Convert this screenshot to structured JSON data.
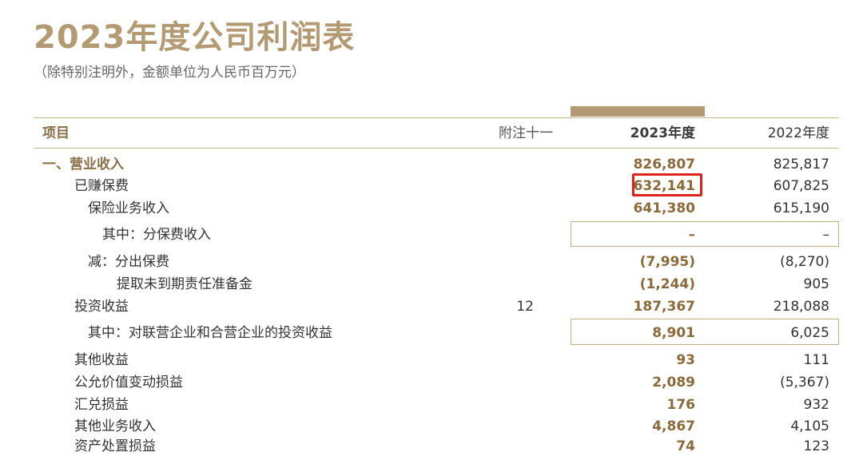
{
  "document": {
    "title": "2023年度公司利润表",
    "subtitle": "（除特别注明外，金额单位为人民币百万元）"
  },
  "table": {
    "headers": {
      "item": "项目",
      "note": "附注十一",
      "current": "2023年度",
      "previous": "2022年度"
    },
    "rows": [
      {
        "label": "一、营业收入",
        "note": "",
        "current": "826,807",
        "previous": "825,817"
      },
      {
        "label": "已赚保费",
        "note": "",
        "current": "632,141",
        "previous": "607,825"
      },
      {
        "label": "保险业务收入",
        "note": "",
        "current": "641,380",
        "previous": "615,190"
      },
      {
        "label": "其中：分保费收入",
        "note": "",
        "current": "–",
        "previous": "–"
      },
      {
        "label": "减：分出保费",
        "note": "",
        "current": "(7,995)",
        "previous": "(8,270)"
      },
      {
        "label": "提取未到期责任准备金",
        "note": "",
        "current": "(1,244)",
        "previous": "905"
      },
      {
        "label": "投资收益",
        "note": "12",
        "current": "187,367",
        "previous": "218,088"
      },
      {
        "label": "其中：对联营企业和合营企业的投资收益",
        "note": "",
        "current": "8,901",
        "previous": "6,025"
      },
      {
        "label": "其他收益",
        "note": "",
        "current": "93",
        "previous": "111"
      },
      {
        "label": "公允价值变动损益",
        "note": "",
        "current": "2,089",
        "previous": "(5,367)"
      },
      {
        "label": "汇兑损益",
        "note": "",
        "current": "176",
        "previous": "932"
      },
      {
        "label": "其他业务收入",
        "note": "",
        "current": "4,867",
        "previous": "4,105"
      },
      {
        "label": "资产处置损益",
        "note": "",
        "current": "74",
        "previous": "123"
      }
    ]
  },
  "highlight": {
    "color": "#e0201c",
    "target": "632,141"
  },
  "colors": {
    "accent_gold": "#b39a72",
    "value_brown": "#8a6a3a"
  }
}
